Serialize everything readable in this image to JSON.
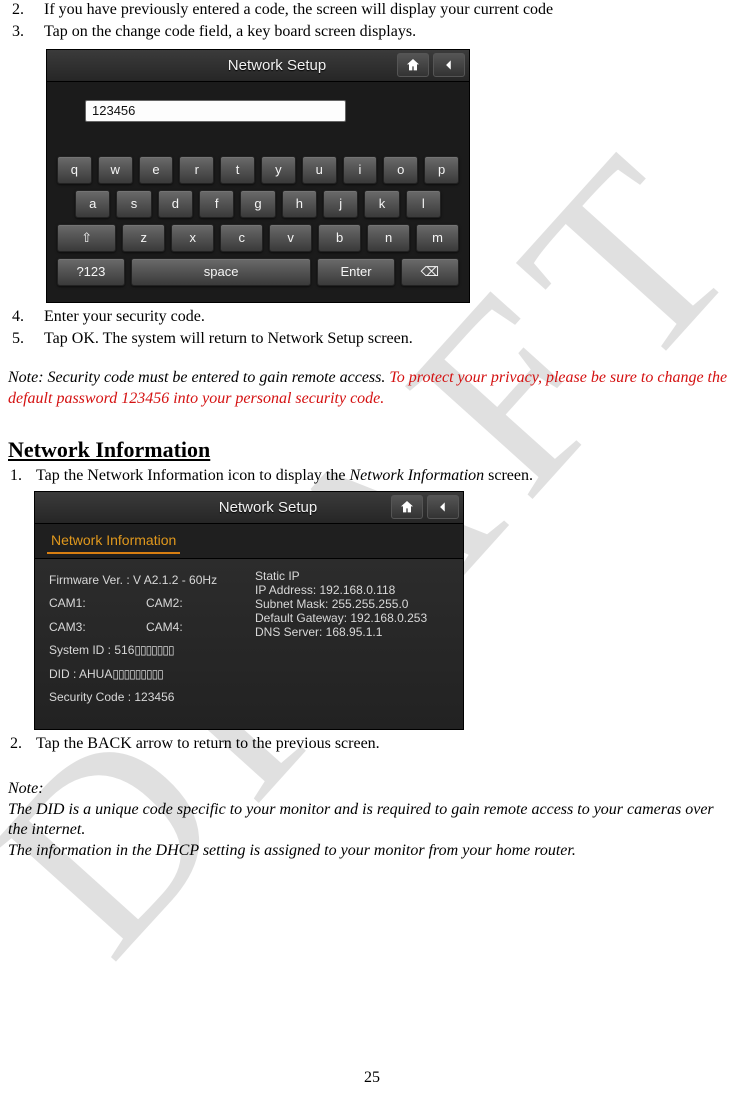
{
  "top_list": [
    {
      "n": "2.",
      "t": "If you have previously entered a code, the screen will display your current code"
    },
    {
      "n": "3.",
      "t": "Tap on the change code field, a key board screen displays."
    }
  ],
  "device1": {
    "title": "Network Setup",
    "input_value": "123456",
    "rows": {
      "r1": [
        "q",
        "w",
        "e",
        "r",
        "t",
        "y",
        "u",
        "i",
        "o",
        "p"
      ],
      "r2": [
        "a",
        "s",
        "d",
        "f",
        "g",
        "h",
        "j",
        "k",
        "l"
      ],
      "r3_shift": "⇧",
      "r3": [
        "z",
        "x",
        "c",
        "v",
        "b",
        "n",
        "m"
      ],
      "r4_123": "?123",
      "r4_space": "space",
      "r4_enter": "Enter",
      "r4_back": "⌫"
    }
  },
  "mid_list": [
    {
      "n": "4.",
      "t": "Enter your security code."
    },
    {
      "n": "5.",
      "t": "Tap OK. The system will return to Network Setup screen."
    }
  ],
  "note1_a": "Note: Security code must be entered to gain remote access.",
  "note1_b": " To protect your privacy, please be sure to change the default password 123456 into your personal security code.",
  "section2_heading": "Network Information",
  "sec2_list1": {
    "n": "1.",
    "t_a": "Tap the Network Information icon to display the ",
    "t_i": "Network Information",
    "t_b": " screen."
  },
  "device2": {
    "title": "Network Setup",
    "tab": "Network Information",
    "left": {
      "firmware": "Firmware Ver. : V A2.1.2 - 60Hz",
      "cam1": "CAM1:",
      "cam2": "CAM2:",
      "cam3": "CAM3:",
      "cam4": "CAM4:",
      "system_id": "System ID : 516",
      "did": "DID : AHUA",
      "sec_code": "Security Code : 123456"
    },
    "right": {
      "static": "Static IP",
      "ip": "IP Address: 192.168.0.118",
      "subnet": "Subnet Mask: 255.255.255.0",
      "gw": "Default Gateway: 192.168.0.253",
      "dns": "DNS Server: 168.95.1.1"
    }
  },
  "sec2_list2": {
    "n": "2.",
    "t": "Tap the BACK arrow to return to the previous screen."
  },
  "note2_head": "Note:",
  "note2_a": "The DID is a unique code specific to your monitor and is required to gain remote access to your cameras over the internet.",
  "note2_b": "The information in the DHCP setting is assigned to your monitor from your home router.",
  "page_num": "25"
}
